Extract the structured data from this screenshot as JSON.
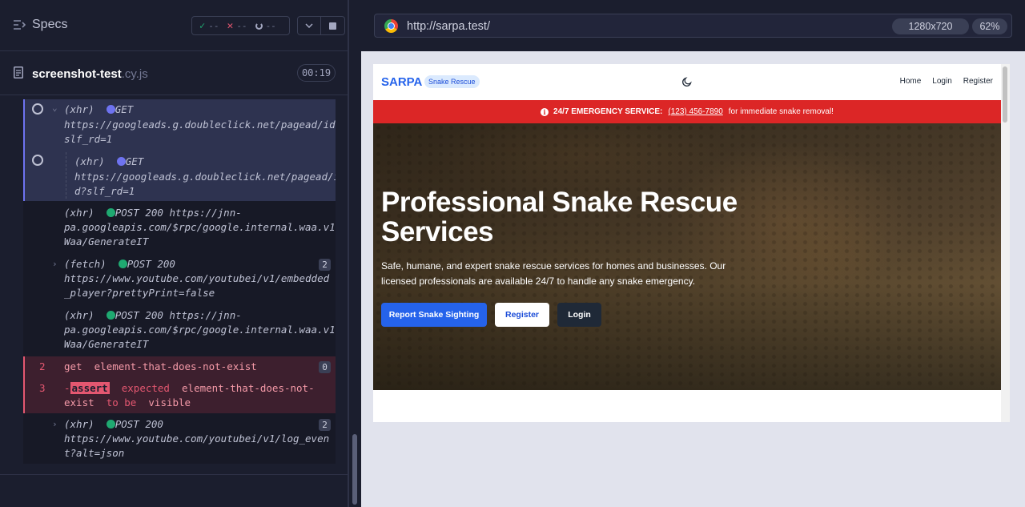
{
  "reporter": {
    "specs_label": "Specs",
    "stats": {
      "passed": "--",
      "failed": "--",
      "pending": "--"
    },
    "file": {
      "name": "screenshot-test",
      "ext": ".cy.js",
      "duration": "00:19"
    },
    "commands": [
      {
        "kind": "(xhr)",
        "method": "GET",
        "line1": "https://googleads.g.doubleclick.net/pagead/id?",
        "line2": "slf_rd=1"
      },
      {
        "kind": "(xhr)",
        "method": "GET",
        "line1": "https://googleads.g.doubleclick.net/pagead/i",
        "line2": "d?slf_rd=1"
      },
      {
        "kind": "(xhr)",
        "method": "POST 200",
        "line1": "https://jnn-",
        "line2": "pa.googleapis.com/$rpc/google.internal.waa.v1.",
        "line3": "Waa/GenerateIT"
      },
      {
        "kind": "(fetch)",
        "method": "POST 200",
        "line1": "https://www.youtube.com/youtubei/v1/embedded",
        "line2": "_player?prettyPrint=false",
        "badge": "2"
      },
      {
        "kind": "(xhr)",
        "method": "POST 200 https://jnn-",
        "line1": "pa.googleapis.com/$rpc/google.internal.waa.v1.",
        "line2": "Waa/GenerateIT"
      },
      {
        "num": "2",
        "name": "get",
        "selector": "element-that-does-not-exist",
        "badge": "0"
      },
      {
        "num": "3",
        "prefix": "-",
        "name": "assert",
        "w1": "expected",
        "w2": "element-that-does-not-",
        "w3": "exist",
        "w4": "to be",
        "w5": "visible"
      },
      {
        "kind": "(xhr)",
        "method": "POST 200",
        "line1": "https://www.youtube.com/youtubei/v1/log_even",
        "line2": "t?alt=json",
        "badge": "2"
      }
    ]
  },
  "browser": {
    "url": "http://sarpa.test/",
    "viewport": "1280x720",
    "zoom": "62%"
  },
  "site": {
    "logo": "SARPA",
    "logo_badge": "Snake Rescue",
    "nav": [
      "Home",
      "Login",
      "Register"
    ],
    "emergency": {
      "label": "24/7 EMERGENCY SERVICE:",
      "phone": "(123) 456-7890",
      "tail": "for immediate snake removal!"
    },
    "hero": {
      "title": "Professional Snake Rescue Services",
      "subtitle": "Safe, humane, and expert snake rescue services for homes and businesses. Our licensed professionals are available 24/7 to handle any snake emergency.",
      "buttons": {
        "report": "Report Snake Sighting",
        "register": "Register",
        "login": "Login"
      }
    }
  },
  "colors": {
    "accent": "#2563eb",
    "emergency": "#dc2626",
    "fail": "#e45770",
    "pass": "#1fa971",
    "xhr_dot": "#6e73f0"
  }
}
